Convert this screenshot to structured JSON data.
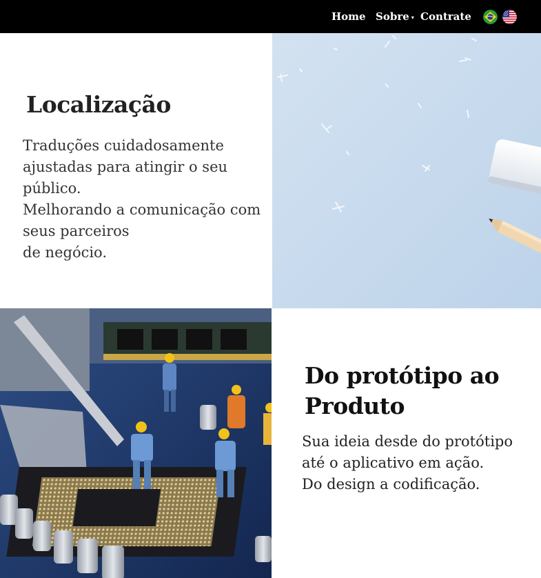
{
  "nav": {
    "items": [
      {
        "label": "Home"
      },
      {
        "label": "Sobre"
      },
      {
        "label": "Contrate"
      }
    ],
    "sobre_caret": "▾",
    "flags": [
      {
        "icon": "brazil-flag-icon"
      },
      {
        "icon": "usa-flag-icon"
      }
    ]
  },
  "section1": {
    "title": "Localização",
    "lines": [
      "Traduções cuidadosamente",
      "ajustadas para atingir o seu",
      "público.",
      "Melhorando a comunicação com",
      "seus parceiros",
      "de negócio."
    ],
    "image_icon": "pencil-eraser-photo"
  },
  "section2": {
    "title_lines": [
      "Do protótipo ao",
      "Produto"
    ],
    "lines": [
      "Sua ideia desde do protótipo",
      "até o aplicativo em ação.",
      "Do design a codificação."
    ],
    "image_icon": "motherboard-workers-photo"
  },
  "colors": {
    "navbar": "#000000",
    "nav_text": "#ffffff",
    "title": "#222222",
    "body": "#333333",
    "pencil_bg": "#c9dcef"
  }
}
